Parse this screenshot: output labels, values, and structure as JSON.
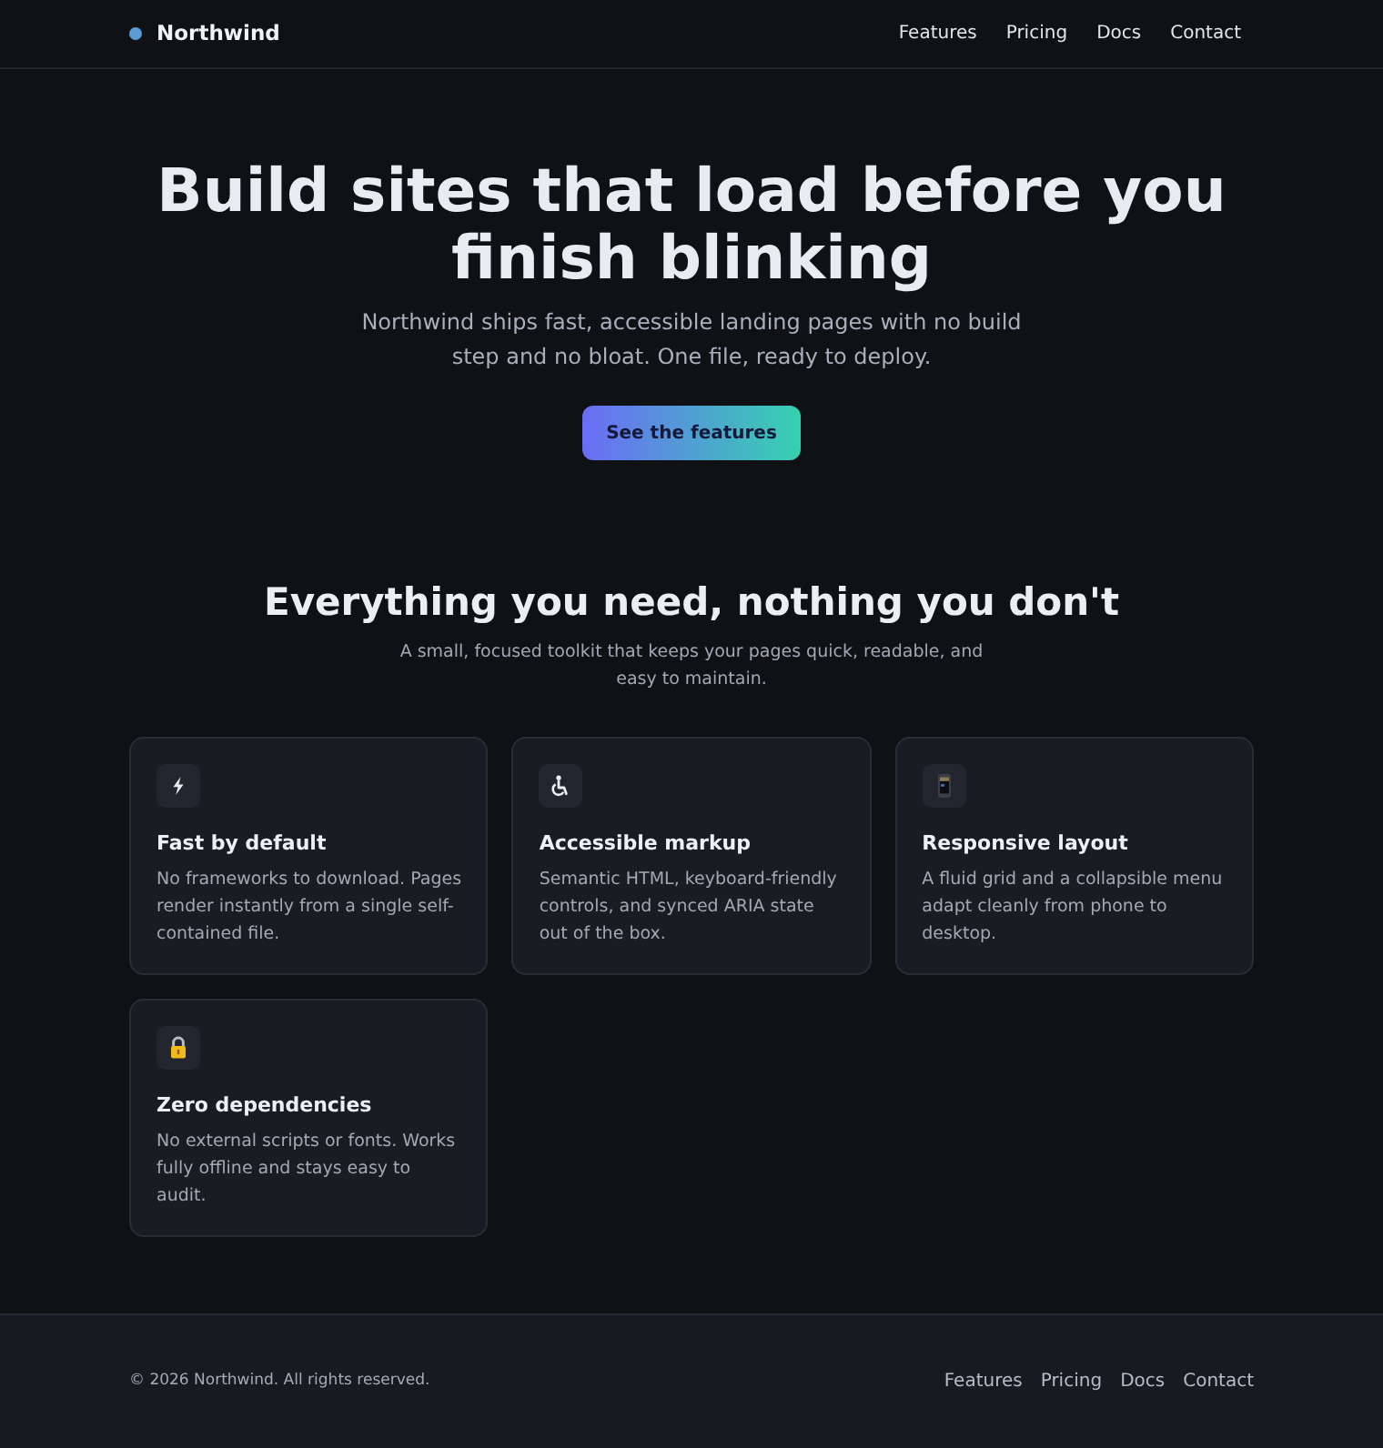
{
  "header": {
    "brand": "Northwind",
    "nav": [
      "Features",
      "Pricing",
      "Docs",
      "Contact"
    ]
  },
  "hero": {
    "title": "Build sites that load before you finish blinking",
    "subtitle": "Northwind ships fast, accessible landing pages with no build step and no bloat. One file, ready to deploy.",
    "button": "See the features"
  },
  "features": {
    "title": "Everything you need, nothing you don't",
    "subtitle": "A small, focused toolkit that keeps your pages quick, readable, and easy to maintain.",
    "cards": [
      {
        "title": "Fast by default",
        "text": "No frameworks to download. Pages render instantly from a single self-contained file."
      },
      {
        "title": "Accessible markup",
        "text": "Semantic HTML, keyboard-friendly controls, and synced ARIA state out of the box."
      },
      {
        "title": "Responsive layout",
        "text": "A fluid grid and a collapsible menu adapt cleanly from phone to desktop."
      },
      {
        "title": "Zero dependencies",
        "text": "No external scripts or fonts. Works fully offline and stays easy to audit."
      }
    ]
  },
  "footer": {
    "copyright": "© 2026 Northwind. All rights reserved.",
    "links": [
      "Features",
      "Pricing",
      "Docs",
      "Contact"
    ]
  }
}
